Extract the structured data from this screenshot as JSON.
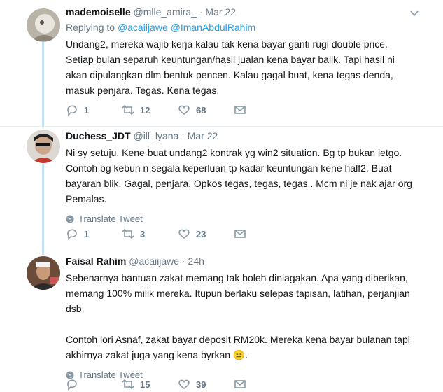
{
  "tweets": [
    {
      "name": "mademoiselle",
      "handle": "@mlle_amira_",
      "dot": "·",
      "date": "Mar 22",
      "replying_label": "Replying to",
      "replying_to": "@acaiijawe @ImanAbdulRahim",
      "text_lines": [
        "Undang2, mereka wajib kerja kalau tak kena bayar ganti rugi double price.",
        "Setiap bulan separuh keuntungan/hasil jualan kena bayar balik. Tapi hasil ni",
        "akan dipulangkan dlm bentuk pencen. Kalau gagal buat, kena tegas denda,",
        "masuk penjara. Tegas. Kena tegas."
      ],
      "replies": "1",
      "retweets": "12",
      "likes": "68"
    },
    {
      "name": "Duchess_JDT",
      "handle": "@ill_lyana",
      "dot": "·",
      "date": "Mar 22",
      "text_lines": [
        "Ni sy setuju. Kene buat undang2 kontrak yg win2 situation. Bg tp bukan letgo.",
        "Contoh bg kebun n segala keperluan tp kadar keuntungan kene half2. Buat",
        "bayaran blik. Gagal, penjara. Opkos tegas, tegas, tegas.. Mcm ni je nak ajar org",
        "Pemalas."
      ],
      "translate": "Translate Tweet",
      "replies": "1",
      "retweets": "3",
      "likes": "23"
    },
    {
      "name": "Faisal Rahim",
      "handle": "@acaiijawe",
      "dot": "·",
      "date": "24h",
      "text_lines": [
        "Sebenarnya bantuan zakat memang tak boleh diniagakan. Apa yang diberikan,",
        "memang 100% milik mereka. Itupun berlaku selepas tapisan, latihan, perjanjian",
        "dsb.",
        "",
        "Contoh lori Asnaf, zakat bayar deposit RM20k. Mereka kena bayar bulanan tapi",
        "akhirnya zakat juga yang kena byrkan 😑."
      ],
      "translate": "Translate Tweet",
      "replies": "",
      "retweets": "15",
      "likes": "39"
    }
  ],
  "colors": {
    "link": "#1da1f2",
    "muted": "#657786",
    "thread": "#c4e3f4"
  }
}
